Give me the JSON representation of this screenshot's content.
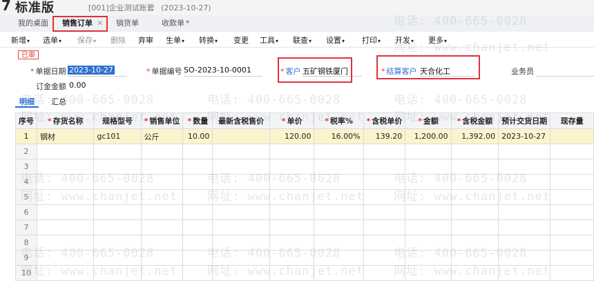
{
  "app": {
    "title": "标准版",
    "account": "[001]企业测试账套",
    "date": "(2023-10-27)"
  },
  "tabs": [
    {
      "label": "我的桌面"
    },
    {
      "label": "销售订单",
      "close": "✕"
    },
    {
      "label": "销货单"
    },
    {
      "label": "收款单",
      "dirty": "*"
    }
  ],
  "toolbar": {
    "items": [
      "新增",
      "选单",
      "保存",
      "删除",
      "弃审",
      "生单",
      "转换",
      "变更",
      "工具",
      "联查",
      "设置",
      "打印",
      "开发",
      "更多"
    ]
  },
  "form": {
    "status": "已审",
    "req_mark": "*",
    "date_label": "单据日期",
    "date_value": "2023-10-27",
    "code_label": "单据编号",
    "code_value": "SO-2023-10-0001",
    "customer_label": "客户",
    "customer_value": "五矿钢铁厦门",
    "settle_label": "结算客户",
    "settle_value": "天合化工",
    "salesman_label": "业务员",
    "amount_label": "订金金额",
    "amount_value": "0.00"
  },
  "subtabs": [
    "明细",
    "汇总"
  ],
  "grid": {
    "headers": [
      "序号",
      "存货名称",
      "规格型号",
      "销售单位",
      "数量",
      "最新含税售价",
      "单价",
      "税率%",
      "含税单价",
      "金额",
      "含税金额",
      "预计交货日期",
      "现存量"
    ],
    "required": [
      false,
      true,
      false,
      true,
      true,
      false,
      true,
      true,
      true,
      true,
      true,
      false,
      false
    ],
    "rows": [
      [
        "1",
        "钢材",
        "gc101",
        "公斤",
        "10.00",
        "",
        "120.00",
        "16.00%",
        "139.20",
        "1,200.00",
        "1,392.00",
        "2023-10-27",
        ""
      ]
    ],
    "empty_rows": [
      "2",
      "3",
      "4",
      "5",
      "6",
      "7",
      "8",
      "9",
      "10"
    ]
  },
  "watermark": {
    "phone": "电话: 400-665-0028",
    "site": "网址: www.chanjet.net"
  }
}
